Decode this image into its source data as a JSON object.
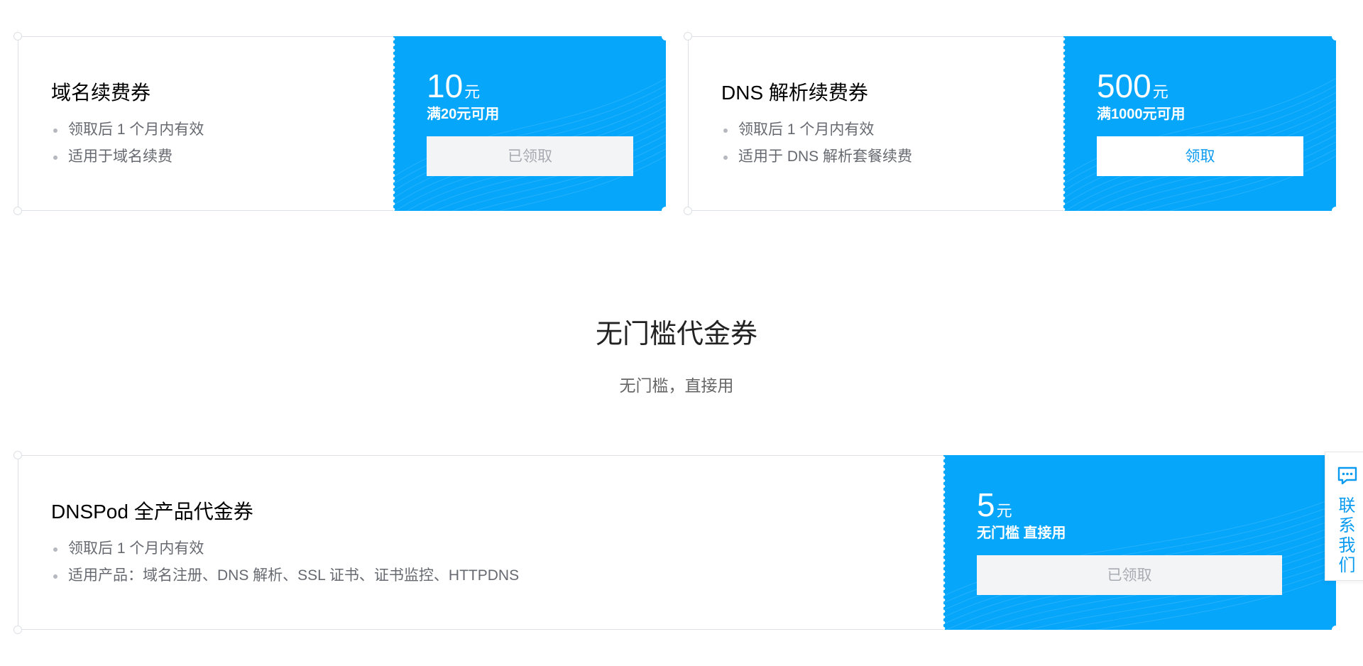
{
  "coupons_top": [
    {
      "title": "域名续费券",
      "bullets": [
        "领取后 1 个月内有效",
        "适用于域名续费"
      ],
      "amount": "10",
      "unit": "元",
      "condition": "满20元可用",
      "button_label": "已领取",
      "claimed": true
    },
    {
      "title": "DNS 解析续费券",
      "bullets": [
        "领取后 1 个月内有效",
        "适用于 DNS 解析套餐续费"
      ],
      "amount": "500",
      "unit": "元",
      "condition": "满1000元可用",
      "button_label": "领取",
      "claimed": false
    }
  ],
  "section": {
    "title": "无门槛代金券",
    "subtitle": "无门槛，直接用"
  },
  "coupon_wide": {
    "title": "DNSPod 全产品代金券",
    "bullets": [
      "领取后 1 个月内有效",
      "适用产品：域名注册、DNS 解析、SSL 证书、证书监控、HTTPDNS"
    ],
    "amount": "5",
    "unit": "元",
    "condition": "无门槛 直接用",
    "button_label": "已领取",
    "claimed": true
  },
  "contact": {
    "label": "联系我们",
    "icon": "chat-icon"
  },
  "colors": {
    "accent": "#06a6fb",
    "link": "#0a9bf0",
    "claimed_bg": "#f3f4f6",
    "claimed_text": "#a7abb1"
  }
}
